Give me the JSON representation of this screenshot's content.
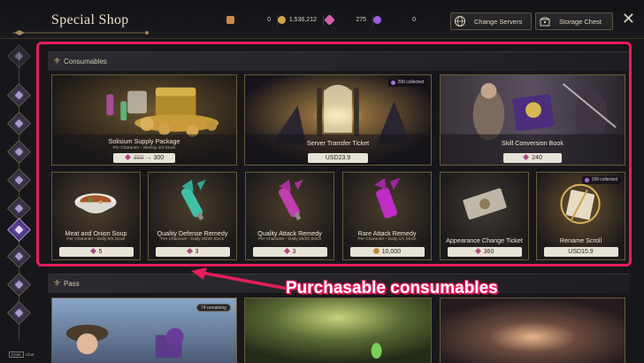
{
  "header": {
    "title": "Special Shop",
    "currencies": [
      {
        "icon": "silver-coin-icon",
        "value": "0",
        "color": "#c98a52"
      },
      {
        "icon": "gold-coin-icon",
        "value": "1,536,212",
        "color": "#d3a548"
      },
      {
        "icon": "crystal-icon",
        "value": "275",
        "color": "#d25fa6"
      },
      {
        "icon": "royal-crystal-icon",
        "value": "0",
        "color": "#9a60e0"
      }
    ],
    "buttons": {
      "change_servers": "Change Servers",
      "storage_chest": "Storage Chest"
    },
    "close_symbol": "✕"
  },
  "sidebar": {
    "items": [
      "featured-icon",
      "package-icon",
      "consumables-icon",
      "pass-icon",
      "cosmetics-icon",
      "mount-icon",
      "pet-icon",
      "crest-icon",
      "misc-icon",
      "limited-icon",
      "event-icon"
    ],
    "active_index": 5,
    "footer_key": "Enter",
    "footer_label": "Chat"
  },
  "sections": {
    "consumables": "Consumables",
    "pass": "Pass"
  },
  "consumables": [
    {
      "name": "Solisium Supply Package",
      "sub": "Per Character - Weekly 4/4 Stock",
      "old_price": "350",
      "price": "300",
      "currency": "crystal"
    },
    {
      "name": "Server Transfer Ticket",
      "price": "USD23.9",
      "currency": "usd",
      "badge": "290 collected"
    },
    {
      "name": "Skill Conversion Book",
      "price": "240",
      "currency": "crystal"
    },
    {
      "name": "Meat and Onion Soup",
      "sub": "Per Character - Daily 5/5 Stock",
      "price": "5",
      "currency": "crystal"
    },
    {
      "name": "Quality Defense Remedy",
      "sub": "Per Character - Daily 25/25 Stock",
      "price": "3",
      "currency": "crystal"
    },
    {
      "name": "Quality Attack Remedy",
      "sub": "Per Character - Daily 25/25 Stock",
      "price": "3",
      "currency": "crystal"
    },
    {
      "name": "Rare Attack Remedy",
      "sub": "Per Character - Daily 1/1 Stock",
      "price": "10,000",
      "currency": "gold"
    },
    {
      "name": "Appearance Change Ticket",
      "price": "360",
      "currency": "crystal"
    },
    {
      "name": "Rename Scroll",
      "price": "USD15.9",
      "currency": "usd",
      "badge": "199 collected"
    }
  ],
  "pass_badge": "74 remaining",
  "annotation": {
    "callout": "Purchasable consumables",
    "highlight_color": "#e51d5b"
  }
}
